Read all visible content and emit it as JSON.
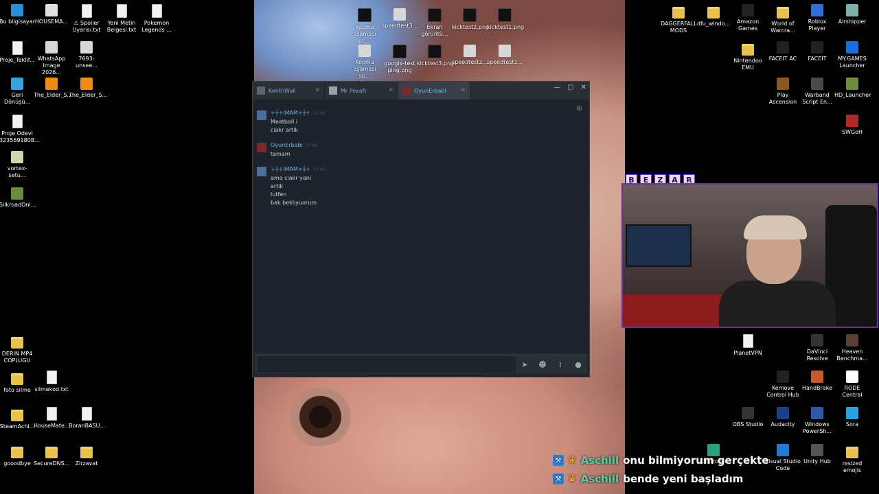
{
  "desktop_left": [
    {
      "label": "Bu bilgisayar",
      "icon": "computer-icon"
    },
    {
      "label": "HOUSEMA...",
      "icon": "chrome-icon"
    },
    {
      "label": "⚠ Spoiler Uyarısı.txt",
      "icon": "file-icon"
    },
    {
      "label": "Yeni Metin Belgesi.txt",
      "icon": "file-icon"
    },
    {
      "label": "Pokemon Legends ...",
      "icon": "file-icon"
    },
    {
      "label": "Proje_Teklif...",
      "icon": "file-icon"
    },
    {
      "label": "WhatsApp Image 2026...",
      "icon": "image-icon"
    },
    {
      "label": "7693-unsee...",
      "icon": "image-icon"
    },
    {
      "label": "Geri Dönüşü...",
      "icon": "recycle-bin-icon"
    },
    {
      "label": "The_Elder_S...",
      "icon": "vlc-icon"
    },
    {
      "label": "The_Elder_S...",
      "icon": "vlc-icon"
    },
    {
      "label": "Proje Odevi 3235691808...",
      "icon": "file-icon"
    },
    {
      "label": "vortex-setu...",
      "icon": "installer-icon"
    },
    {
      "label": "SilkroadOnl...",
      "icon": "game-icon"
    },
    {
      "label": "DERIN MP4 COPLUGU",
      "icon": "folder-icon"
    },
    {
      "label": "foto silme",
      "icon": "folder-icon"
    },
    {
      "label": "silmekod.txt",
      "icon": "file-icon"
    },
    {
      "label": "SteamAchi...",
      "icon": "folder-icon"
    },
    {
      "label": "HouseMate...",
      "icon": "file-icon"
    },
    {
      "label": "BoranBASU...",
      "icon": "file-icon"
    },
    {
      "label": "gooodbye",
      "icon": "folder-icon"
    },
    {
      "label": "SecureDNS...",
      "icon": "folder-icon"
    },
    {
      "label": "Zirzavat",
      "icon": "folder-icon"
    }
  ],
  "desktop_center": [
    {
      "label": "Kopma aşaması ob...",
      "icon": "black-image-icon"
    },
    {
      "label": "speedtest3...",
      "icon": "image-icon"
    },
    {
      "label": "Ekran görüntü...",
      "icon": "black-image-icon"
    },
    {
      "label": "kicktest2.png",
      "icon": "black-image-icon"
    },
    {
      "label": "kicktest1.png",
      "icon": "black-image-icon"
    },
    {
      "label": "Kopma aşaması sp...",
      "icon": "image-icon"
    },
    {
      "label": "google-test ping.png",
      "icon": "black-image-icon"
    },
    {
      "label": "kicktest3.png",
      "icon": "black-image-icon"
    },
    {
      "label": "speedtest2...",
      "icon": "image-icon"
    },
    {
      "label": "speedtest1...",
      "icon": "image-icon"
    }
  ],
  "desktop_right": [
    {
      "label": "DAGGERFALL MODS",
      "icon": "folder-icon"
    },
    {
      "label": "dfu_windo...",
      "icon": "folder-icon"
    },
    {
      "label": "Amazon Games",
      "icon": "amazon-games-icon"
    },
    {
      "label": "World of Warcra...",
      "icon": "folder-icon"
    },
    {
      "label": "Roblox Player",
      "icon": "roblox-icon"
    },
    {
      "label": "Airshipper",
      "icon": "airshipper-icon"
    },
    {
      "label": "Nintendoo EMU",
      "icon": "folder-icon"
    },
    {
      "label": "FACEIT AC",
      "icon": "faceit-icon"
    },
    {
      "label": "FACEIT",
      "icon": "faceit-icon"
    },
    {
      "label": "MY.GAMES Launcher",
      "icon": "mygames-icon"
    },
    {
      "label": "Play Ascension",
      "icon": "ascension-icon"
    },
    {
      "label": "Warband Script En...",
      "icon": "warband-icon"
    },
    {
      "label": "HD_Launcher",
      "icon": "launcher-icon"
    },
    {
      "label": "SWGoH",
      "icon": "swgoh-icon"
    },
    {
      "label": "PlanetVPN",
      "icon": "file-icon"
    },
    {
      "label": "DaVinci Resolve",
      "icon": "davinci-icon"
    },
    {
      "label": "Heaven Benchma...",
      "icon": "heaven-icon"
    },
    {
      "label": "Kemove Control Hub",
      "icon": "kemove-icon"
    },
    {
      "label": "HandBrake",
      "icon": "handbrake-icon"
    },
    {
      "label": "RODE Central",
      "icon": "rode-icon"
    },
    {
      "label": "OBS Studio",
      "icon": "obs-icon"
    },
    {
      "label": "Audacity",
      "icon": "audacity-icon"
    },
    {
      "label": "Windows PowerSh...",
      "icon": "powershell-icon"
    },
    {
      "label": "Sora",
      "icon": "sora-icon"
    },
    {
      "label": "Controller",
      "icon": "controller-icon"
    },
    {
      "label": "Visual Studio Code",
      "icon": "vscode-icon"
    },
    {
      "label": "Unity Hub",
      "icon": "unity-icon"
    },
    {
      "label": "resized emojis",
      "icon": "folder-icon"
    }
  ],
  "chat": {
    "tabs": [
      {
        "name": "KenthWall",
        "active": false
      },
      {
        "name": "Mr PexaR",
        "active": false
      },
      {
        "name": "OyunErbabi",
        "active": true
      }
    ],
    "controls": {
      "minimize": "—",
      "maximize": "▢",
      "close": "✕"
    },
    "messages": [
      {
        "sender": "+┼+IMAM+┼+",
        "time": "17:44",
        "lines": [
          "Meatball i",
          "ciakr artik"
        ]
      },
      {
        "sender": "OyunErbabi",
        "time": "17:45",
        "lines": [
          "tamam"
        ]
      },
      {
        "sender": "+┼+IMAM+┼+",
        "time": "17:46",
        "lines": [
          "ama ciakr yani",
          "artik",
          "lutfen",
          "bak bekliyuorum"
        ]
      }
    ],
    "input_placeholder": ""
  },
  "webcam_letters": [
    "B",
    "E",
    "Z",
    "A",
    "R"
  ],
  "stream_chat": [
    {
      "user": "Aschill",
      "text": "onu bilmiyorum gerçekte"
    },
    {
      "user": "Aschill",
      "text": "bende yeni başladım"
    }
  ],
  "colors": {
    "accent": "#66c0f4",
    "chat_bg": "#1f232b",
    "webcam_border": "#6a2fa6",
    "stream_user": "#4ed2a2"
  }
}
